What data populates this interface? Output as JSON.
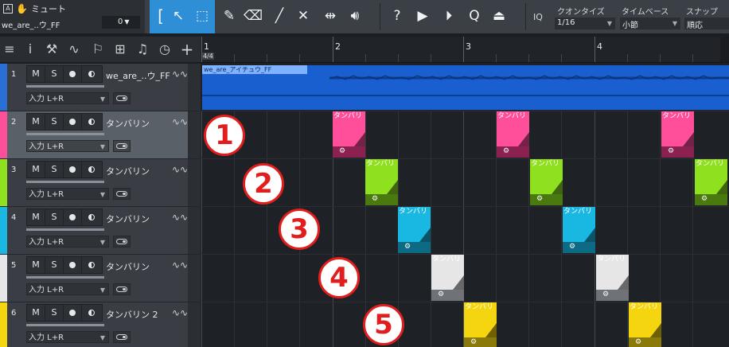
{
  "toolbar": {
    "mute_label": "ミュート",
    "track_name": "we_are_..ウ_FF",
    "count_value": "0",
    "quantize": {
      "label": "クオンタイズ",
      "value": "1/16"
    },
    "timebase": {
      "label": "タイムベース",
      "value": "小節"
    },
    "snap": {
      "label": "スナップ",
      "value": "順応"
    },
    "iq_label": "IQ",
    "a_label": "A"
  },
  "ruler": {
    "bars": [
      "1",
      "2",
      "3",
      "4"
    ],
    "time_signature": "4/4"
  },
  "tracks": [
    {
      "num": "1",
      "name": "we_are_..ウ_FF",
      "input": "入力 L+R",
      "color": "#2a6fd6",
      "m": "M",
      "s": "S"
    },
    {
      "num": "2",
      "name": "タンバリン",
      "input": "入力 L+R",
      "color": "#ff4f9a",
      "m": "M",
      "s": "S"
    },
    {
      "num": "3",
      "name": "タンバリン",
      "input": "入力 L+R",
      "color": "#8fe01f",
      "m": "M",
      "s": "S"
    },
    {
      "num": "4",
      "name": "タンバリン",
      "input": "入力 L+R",
      "color": "#19b8e3",
      "m": "M",
      "s": "S"
    },
    {
      "num": "5",
      "name": "タンバリン",
      "input": "入力 L+R",
      "color": "#e6e6e6",
      "m": "M",
      "s": "S"
    },
    {
      "num": "6",
      "name": "タンバリン 2",
      "input": "入力 L+R",
      "color": "#f5d50f",
      "m": "M",
      "s": "S"
    }
  ],
  "audio_clip_title": "we_are_アイチュウ_FF",
  "event_label": "タンバリ",
  "annotations": [
    "1",
    "2",
    "3",
    "4",
    "5"
  ]
}
